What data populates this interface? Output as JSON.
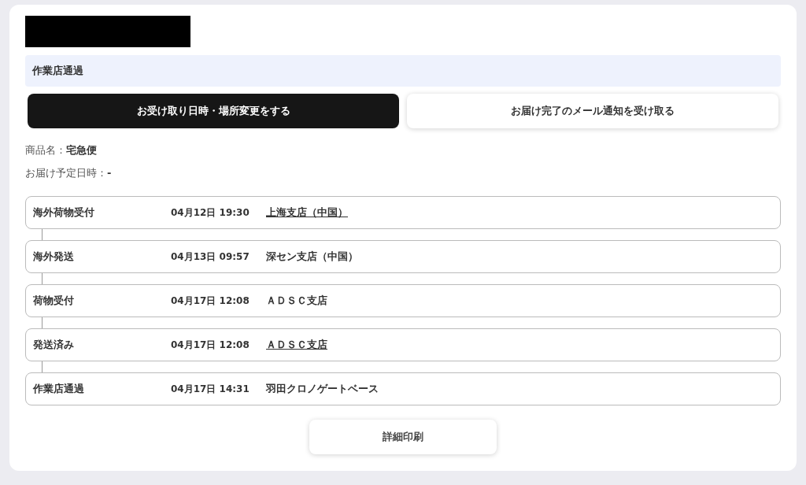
{
  "status_banner": "作業店通過",
  "actions": [
    {
      "label": "お受け取り日時・場所変更をする",
      "kind": "primary"
    },
    {
      "label": "お届け完了のメール通知を受け取る",
      "kind": "secondary"
    }
  ],
  "info": [
    {
      "label": "商品名：",
      "value": "宅急便"
    },
    {
      "label": "お届け予定日時：",
      "value": "-"
    }
  ],
  "timeline": [
    {
      "status": "海外荷物受付",
      "datetime": "04月12日 19:30",
      "location": "上海支店（中国）",
      "linked": true
    },
    {
      "status": "海外発送",
      "datetime": "04月13日 09:57",
      "location": "深セン支店（中国）",
      "linked": false
    },
    {
      "status": "荷物受付",
      "datetime": "04月17日 12:08",
      "location": "ＡＤＳＣ支店",
      "linked": false
    },
    {
      "status": "発送済み",
      "datetime": "04月17日 12:08",
      "location": "ＡＤＳＣ支店",
      "linked": true
    },
    {
      "status": "作業店通過",
      "datetime": "04月17日 14:31",
      "location": "羽田クロノゲートベース",
      "linked": false
    }
  ],
  "print_button": "詳細印刷"
}
